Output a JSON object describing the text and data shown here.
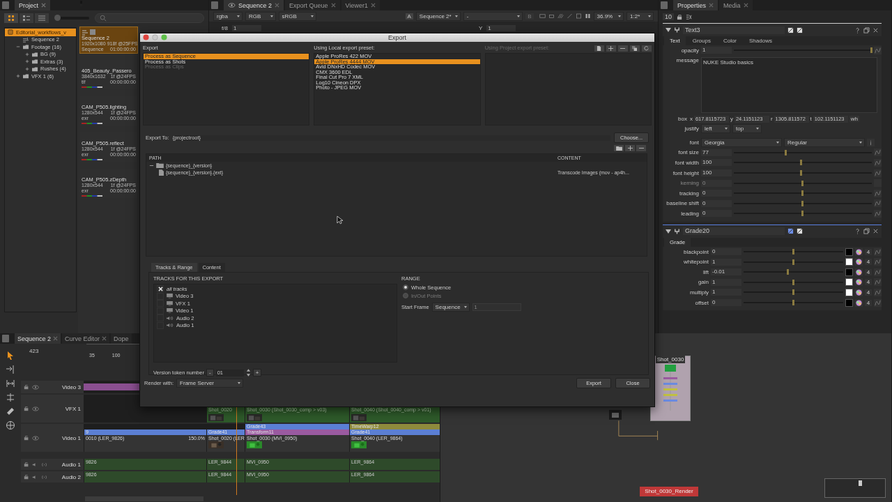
{
  "project": {
    "tab": "Project",
    "thumbnail_size": {
      "level": 0
    },
    "tree": [
      {
        "label": "Editorial_workflows_v",
        "kind": "project",
        "selected": true,
        "children": [
          {
            "label": "Sequence 2",
            "kind": "sequence",
            "selected": false
          },
          {
            "label": "Footage (16)",
            "kind": "bin",
            "selected": false,
            "expanded": true,
            "children": [
              {
                "label": "BG (9)",
                "kind": "bin",
                "selected": false,
                "expanded": false
              },
              {
                "label": "Extras (3)",
                "kind": "bin",
                "selected": false,
                "expanded": false
              },
              {
                "label": "Rushes (4)",
                "kind": "bin",
                "selected": false,
                "expanded": false
              }
            ]
          },
          {
            "label": "VFX 1 (6)",
            "kind": "bin",
            "selected": false,
            "expanded": false
          }
        ]
      }
    ],
    "bins": [
      {
        "kind": "sequence",
        "title": "Sequence 2",
        "resolution": "1920x1080",
        "duration": "918f @25FPS",
        "type": "Sequence",
        "timecode": "01:00:00:00",
        "selected": true
      },
      {
        "kind": "clip",
        "title": "405_Beauty_Passero",
        "resolution": "3840x1632",
        "duration": "1f @24FPS",
        "type": "tif",
        "timecode": "00:00:00:00",
        "selected": false
      },
      {
        "kind": "clip",
        "title": "CAM_P505.lighting",
        "resolution": "1280x544",
        "duration": "1f @24FPS",
        "type": "exr",
        "timecode": "00:00:00:00",
        "selected": false
      },
      {
        "kind": "clip",
        "title": "CAM_P505.reflect",
        "resolution": "1280x544",
        "duration": "1f @24FPS",
        "type": "exr",
        "timecode": "00:00:00:00",
        "selected": false
      },
      {
        "kind": "clip",
        "title": "CAM_P505.zDepth",
        "resolution": "1280x544",
        "duration": "1f @24FPS",
        "type": "exr",
        "timecode": "00:00:00:00",
        "selected": false
      }
    ]
  },
  "viewer": {
    "tabs": [
      {
        "label": "Sequence 2",
        "selected": true
      },
      {
        "label": "Export Queue",
        "selected": false
      },
      {
        "label": "Viewer1",
        "selected": false
      }
    ],
    "toolbar": {
      "channels": "rgba",
      "colorspace": "RGB",
      "lut": "sRGB",
      "a_label": "A",
      "a_input": "Sequence 2*",
      "a_op": "-",
      "b_label": "B",
      "zoom": "36.9%",
      "proxy": "1:2*"
    },
    "controls": {
      "fstop": "f/8",
      "gain": "1",
      "gamma_label": "Y",
      "gamma": "1"
    }
  },
  "export_dialog": {
    "title": "Export",
    "export_label": "Export",
    "export_modes": [
      {
        "label": "Process as Sequence",
        "selected": true,
        "disabled": false
      },
      {
        "label": "Process as Shots",
        "selected": false,
        "disabled": false
      },
      {
        "label": "Process as Clips",
        "selected": false,
        "disabled": true
      }
    ],
    "local_label": "Using Local export preset:",
    "local_presets": [
      {
        "label": "Apple ProRes 422 MOV",
        "selected": false
      },
      {
        "label": "Apple ProRes 4444 MOV",
        "selected": true
      },
      {
        "label": "Avid DNxHD Codec MOV",
        "selected": false
      },
      {
        "label": "CMX 3600 EDL",
        "selected": false
      },
      {
        "label": "Final Cut Pro 7 XML",
        "selected": false
      },
      {
        "label": "Log10 Cineon DPX",
        "selected": false
      },
      {
        "label": "Photo - JPEG MOV",
        "selected": false
      }
    ],
    "project_label": "Using Project export preset:",
    "export_to_label": "Export To:",
    "export_to": "{projectroot}",
    "choose_button": "Choose...",
    "path_columns": [
      "PATH",
      "CONTENT"
    ],
    "path_tree": [
      {
        "label": "{sequence}_{version}",
        "kind": "folder",
        "children": [
          {
            "label": "{sequence}_{version}.{ext}",
            "kind": "file",
            "content": "Transcode Images (mov - ap4h..."
          }
        ]
      }
    ],
    "tabs": [
      {
        "label": "Tracks & Range",
        "selected": true
      },
      {
        "label": "Content",
        "selected": false
      }
    ],
    "tracks_heading": "TRACKS FOR THIS EXPORT",
    "tracks": [
      {
        "label": "all tracks",
        "kind": "all",
        "checked": true
      },
      {
        "label": "Video 3",
        "kind": "video",
        "checked": false
      },
      {
        "label": "VFX 1",
        "kind": "video",
        "checked": false
      },
      {
        "label": "Video 1",
        "kind": "video",
        "checked": false
      },
      {
        "label": "Audio 2",
        "kind": "audio",
        "checked": false
      },
      {
        "label": "Audio 1",
        "kind": "audio",
        "checked": false
      }
    ],
    "range_heading": "RANGE",
    "range_options": [
      {
        "label": "Whole Sequence",
        "selected": true,
        "disabled": false
      },
      {
        "label": "In/Out Points",
        "selected": false,
        "disabled": true
      }
    ],
    "start_frame_label": "Start Frame",
    "start_frame_mode": "Sequence",
    "start_frame": "1",
    "version_label": "Version token number",
    "version_minus": "-",
    "version": "01",
    "version_plus": "+",
    "render_label": "Render with:",
    "render_with": "Frame Server",
    "buttons": [
      "Export",
      "Close"
    ]
  },
  "properties": {
    "tabs": [
      {
        "label": "Properties",
        "selected": true
      },
      {
        "label": "Media",
        "selected": false
      }
    ],
    "max_panels": "10",
    "text_node": {
      "name": "Text3",
      "tabs": [
        {
          "label": "Text",
          "selected": true
        },
        {
          "label": "Groups",
          "selected": false
        },
        {
          "label": "Color",
          "selected": false
        },
        {
          "label": "Shadows",
          "selected": false
        }
      ],
      "opacity": {
        "label": "opacity",
        "value": "1",
        "level": 1
      },
      "message_label": "message",
      "message": "NUKE Studio basics",
      "box_label": "box",
      "box": [
        {
          "label": "x",
          "value": "617.8115723"
        },
        {
          "label": "y",
          "value": "24.1151123"
        },
        {
          "label": "r",
          "value": "1305.811572"
        },
        {
          "label": "t",
          "value": "102.1151123"
        }
      ],
      "box_button": "wh",
      "justify_label": "justify",
      "justify": [
        "left",
        "top"
      ],
      "font_label": "font",
      "font_family": "Georgia",
      "font_style": "Regular",
      "sliders": [
        {
          "label": "font size",
          "value": "77",
          "level": 0.38,
          "disabled": false
        },
        {
          "label": "font width",
          "value": "100",
          "level": 0.49,
          "disabled": false
        },
        {
          "label": "font height",
          "value": "100",
          "level": 0.49,
          "disabled": false
        },
        {
          "label": "kerning",
          "value": "0",
          "level": 0.5,
          "disabled": true
        },
        {
          "label": "tracking",
          "value": "0",
          "level": 0.5,
          "disabled": false
        },
        {
          "label": "baseline shift",
          "value": "0",
          "level": 0.5,
          "disabled": false
        },
        {
          "label": "leading",
          "value": "0",
          "level": 0.5,
          "disabled": false
        }
      ]
    },
    "grade_node": {
      "name": "Grade20",
      "tabs": [
        {
          "label": "Grade",
          "selected": true
        }
      ],
      "rows": [
        {
          "label": "blackpoint",
          "value": "0",
          "level": 0.5,
          "color": "#000000",
          "channels": "4"
        },
        {
          "label": "whitepoint",
          "value": "1",
          "level": 0.5,
          "color": "#ffffff",
          "channels": "4"
        },
        {
          "label": "lift",
          "value": "-0.01",
          "level": 0.45,
          "color": "#000000",
          "channels": "4"
        },
        {
          "label": "gain",
          "value": "1",
          "level": 0.5,
          "color": "#ffffff",
          "channels": "4"
        },
        {
          "label": "multiply",
          "value": "1",
          "level": 0.5,
          "color": "#ffffff",
          "channels": "4"
        },
        {
          "label": "offset",
          "value": "0",
          "level": 0.5,
          "color": "#000000",
          "channels": "4"
        }
      ]
    }
  },
  "timeline": {
    "tabs": [
      {
        "label": "Sequence 2",
        "selected": true
      },
      {
        "label": "Curve Editor",
        "selected": false
      },
      {
        "label": "Dope",
        "selected": false
      }
    ],
    "timecode": "423",
    "ruler": [
      "35",
      "100"
    ],
    "tracks": [
      {
        "name": "Video 3",
        "kind": "video",
        "clips": [
          {
            "kind": "bar",
            "color": "#8a4f90"
          }
        ]
      },
      {
        "name": "VFX 1",
        "kind": "video",
        "clips": [
          {
            "kind": "gap"
          },
          {
            "kind": "vfx",
            "label": "Shot_0020"
          },
          {
            "kind": "vfx",
            "label": "Shot_0030 (Shot_0030_comp > v03)"
          },
          {
            "kind": "vfx",
            "label": "Shot_0040 (Shot_0040_comp > v01)"
          }
        ]
      },
      {
        "name": "Video 1",
        "kind": "video",
        "clips": [
          {
            "kind": "video",
            "label": "0010 (LER_9826)",
            "speed": "150.0%",
            "effects": [
              {
                "label": "9",
                "color": "#5b7fd4"
              }
            ]
          },
          {
            "kind": "video",
            "label": "Shot_0020 (LER",
            "effects": [
              {
                "label": "Grade41",
                "color": "#5b7fd4"
              }
            ]
          },
          {
            "kind": "video",
            "label": "Shot_0030 (MVI_0950)",
            "effects": [
              {
                "label": "Grade43",
                "color": "#5b7fd4"
              },
              {
                "label": "Transform11",
                "color": "#9a5aa0"
              }
            ]
          },
          {
            "kind": "video",
            "label": "Shot_0040 (LER_9864)",
            "effects": [
              {
                "label": "TimeWarp12",
                "color": "#8e8a3c"
              },
              {
                "label": "Grade41",
                "color": "#5b7fd4"
              }
            ]
          }
        ]
      },
      {
        "name": "Audio 1",
        "kind": "audio",
        "clips": [
          {
            "kind": "audio",
            "label": "9826"
          },
          {
            "kind": "audio",
            "label": "LER_9844"
          },
          {
            "kind": "audio",
            "label": "MVI_0950"
          },
          {
            "kind": "audio",
            "label": "LER_9864"
          }
        ]
      },
      {
        "name": "Audio 2",
        "kind": "audio",
        "clips": [
          {
            "kind": "audio",
            "label": "9826"
          },
          {
            "kind": "audio",
            "label": "LER_9844"
          },
          {
            "kind": "audio",
            "label": "MVI_0950"
          },
          {
            "kind": "audio",
            "label": "LER_9864"
          }
        ]
      }
    ]
  },
  "node_graph": {
    "nodes": [
      {
        "label": "Shot_0030",
        "kind": "group"
      },
      {
        "kind": "read"
      },
      {
        "label": "Shot_0030_Render",
        "kind": "write"
      }
    ]
  }
}
